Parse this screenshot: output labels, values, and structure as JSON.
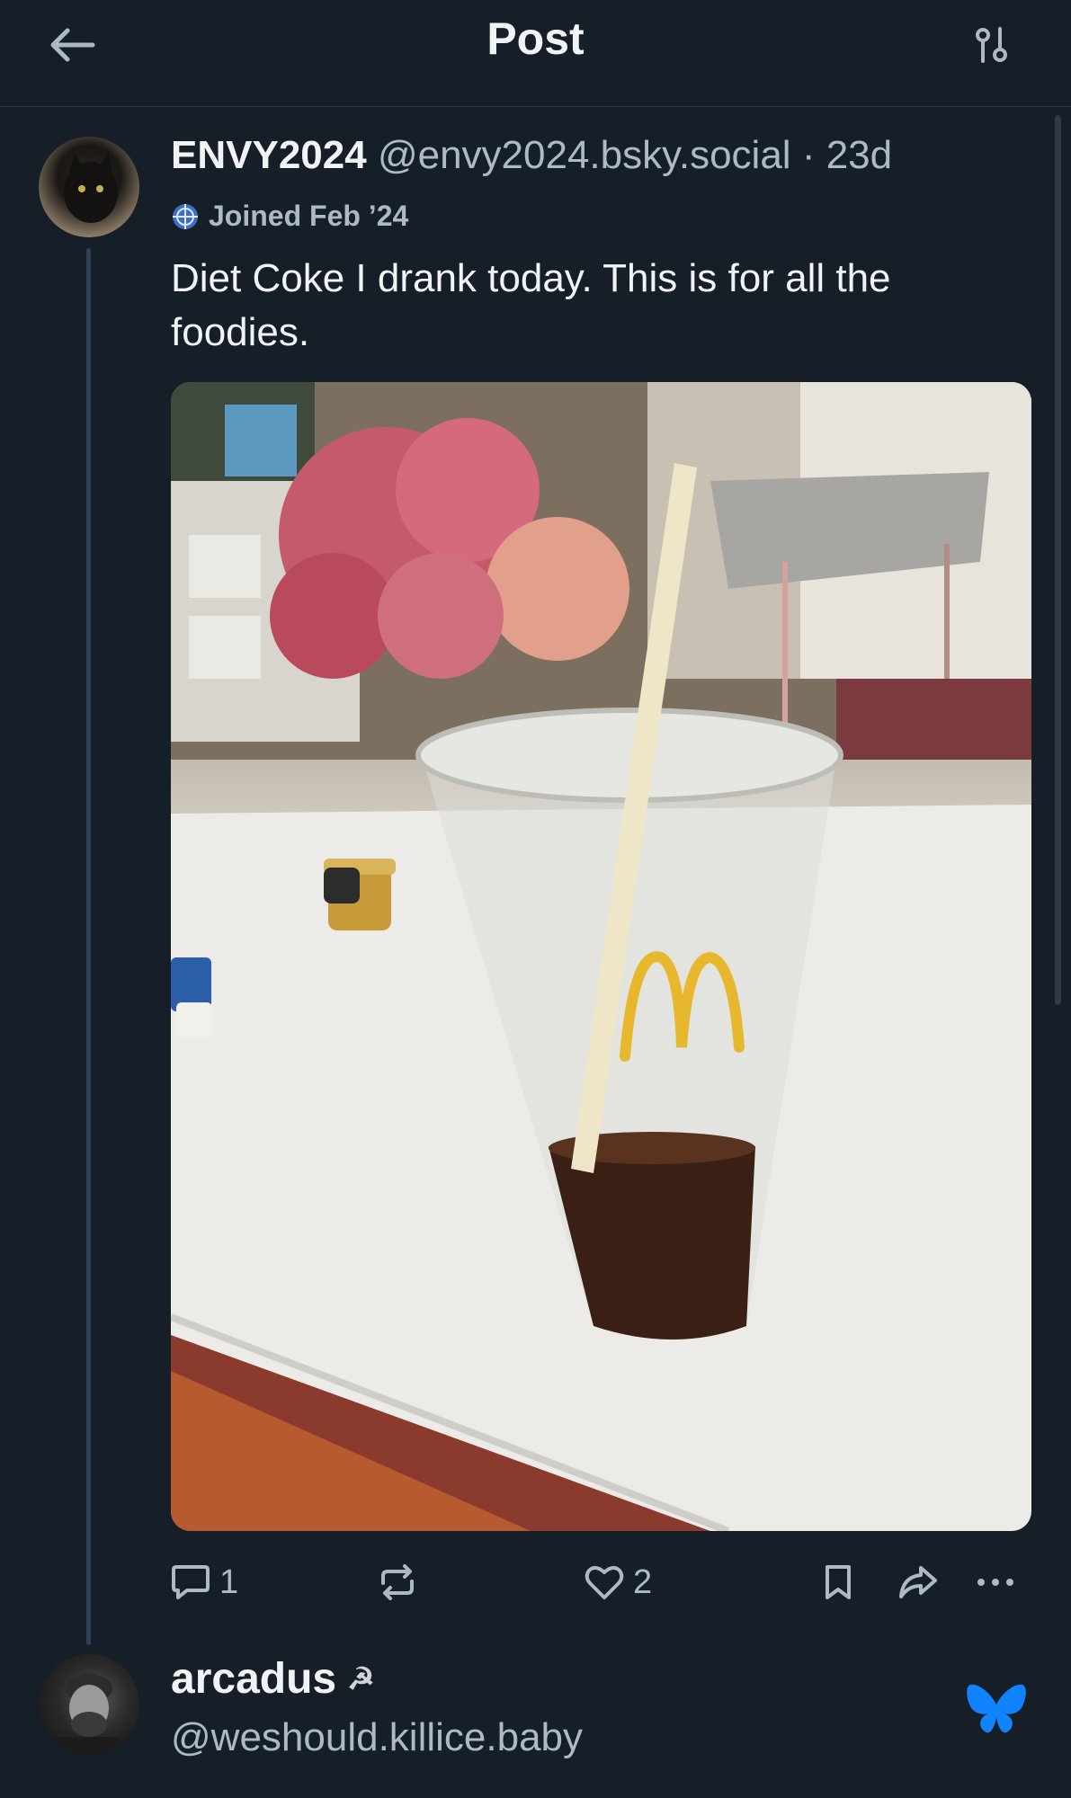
{
  "header": {
    "title": "Post",
    "back_icon": "arrow-left-icon",
    "filter_icon": "sliders-icon"
  },
  "post": {
    "display_name": "ENVY2024",
    "handle": "@envy2024.bsky.social",
    "separator": " · ",
    "age": "23d",
    "joined": "Joined Feb ’24",
    "text": "Diet Coke I drank today.  This is for all the foodies.",
    "image_alt": "McDonald's cup with straw on a white table",
    "actions": {
      "replies": "1",
      "likes": "2"
    }
  },
  "reply": {
    "display_name": "arcadus",
    "name_emoji": "☭",
    "handle": "@weshould.killice.baby"
  },
  "colors": {
    "background": "#161e27",
    "text_primary": "#f1f3f5",
    "text_secondary": "#aeb9c6",
    "accent": "#1083fe",
    "thread_line": "#2f3f55"
  }
}
